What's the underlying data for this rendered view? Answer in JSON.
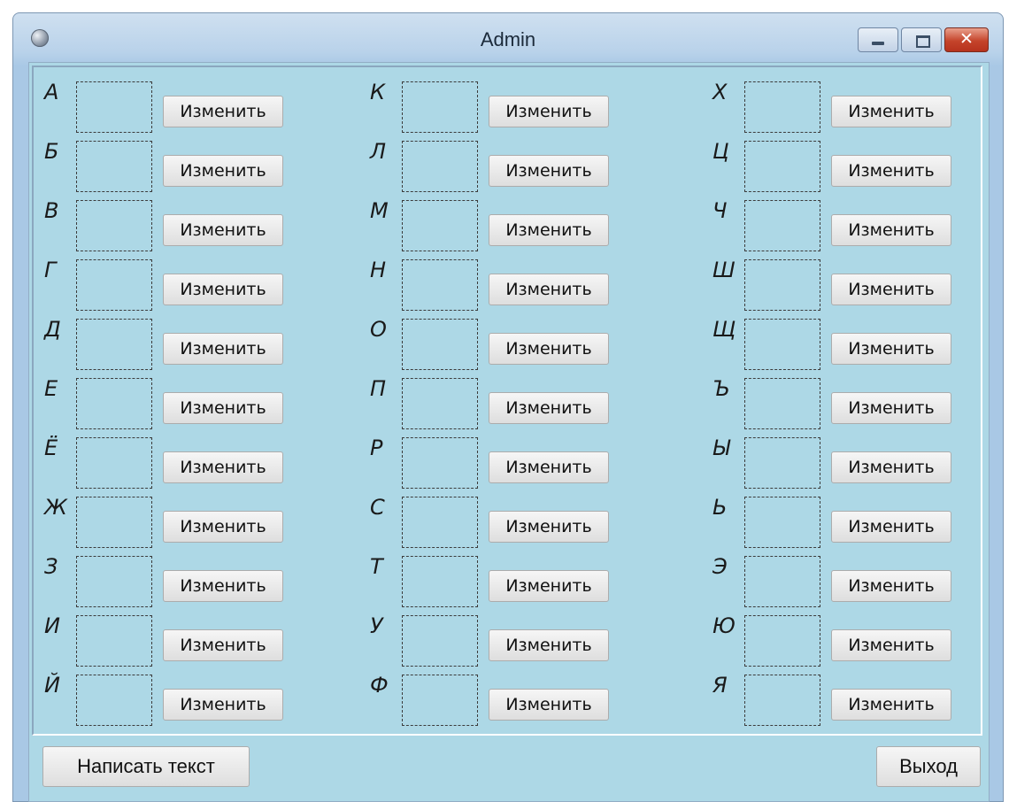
{
  "window": {
    "title": "Admin"
  },
  "letters": [
    "А",
    "Б",
    "В",
    "Г",
    "Д",
    "Е",
    "Ё",
    "Ж",
    "З",
    "И",
    "Й",
    "К",
    "Л",
    "М",
    "Н",
    "О",
    "П",
    "Р",
    "С",
    "Т",
    "У",
    "Ф",
    "Х",
    "Ц",
    "Ч",
    "Ш",
    "Щ",
    "Ъ",
    "Ы",
    "Ь",
    "Э",
    "Ю",
    "Я"
  ],
  "change_button_label": "Изменить",
  "buttons": {
    "write_text": "Написать текст",
    "exit": "Выход"
  }
}
